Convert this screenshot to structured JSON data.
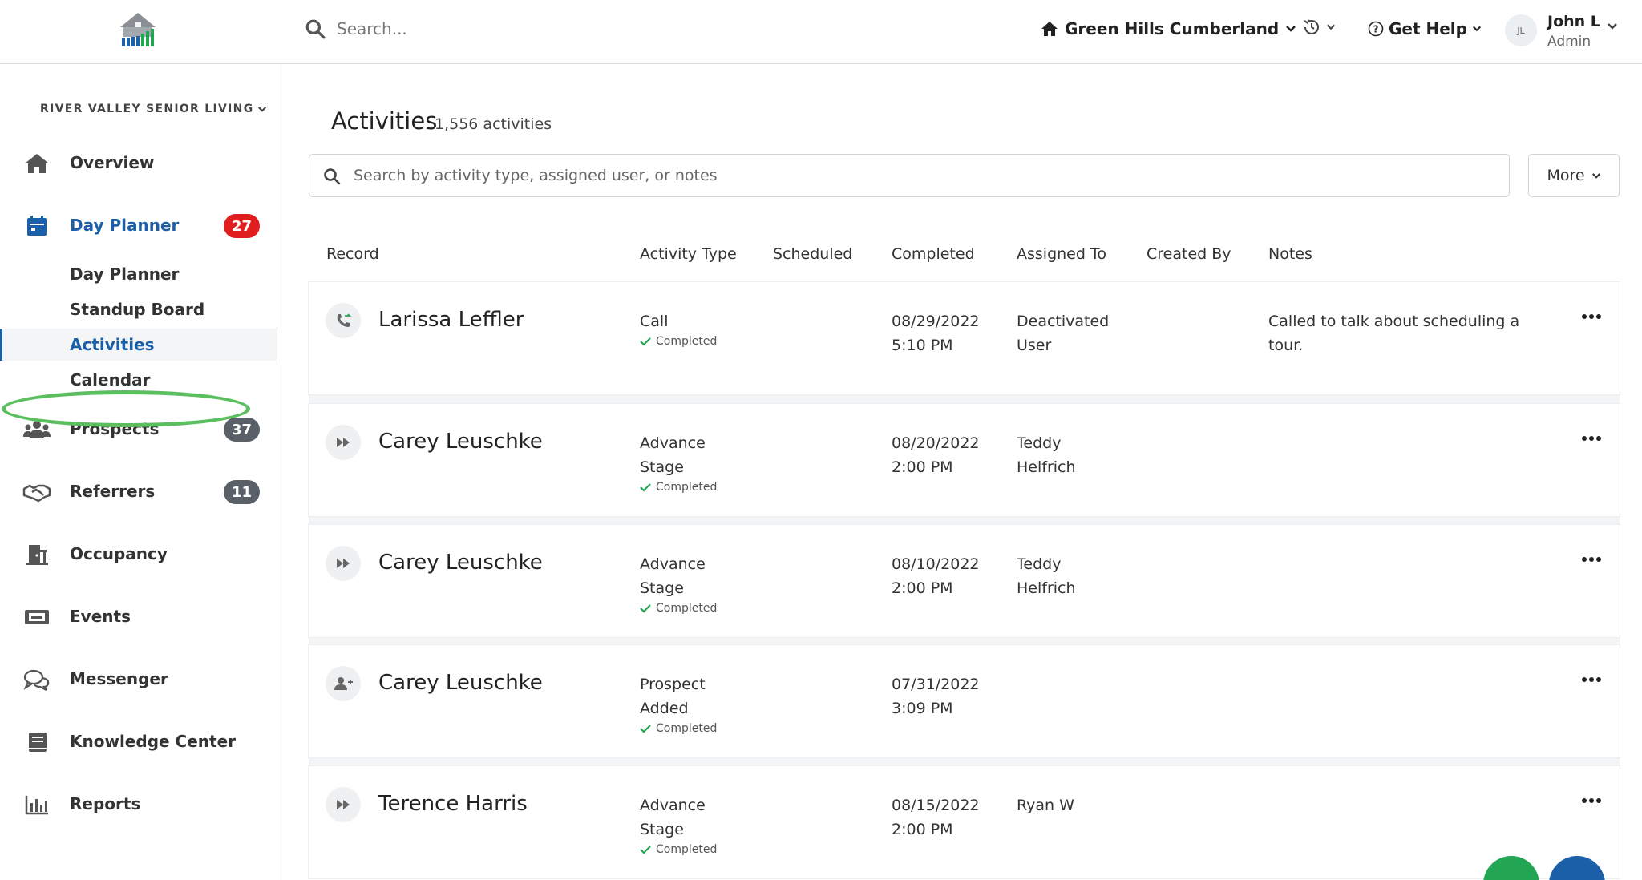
{
  "topbar": {
    "search_placeholder": "Search...",
    "community": "Green Hills Cumberland",
    "help": "Get Help",
    "user": {
      "initials": "JL",
      "name": "John L",
      "role": "Admin"
    }
  },
  "sidebar": {
    "org": "RIVER VALLEY SENIOR LIVING",
    "overview": "Overview",
    "day_planner": {
      "label": "Day Planner",
      "badge": "27"
    },
    "sub_items": [
      "Day Planner",
      "Standup Board",
      "Activities",
      "Calendar"
    ],
    "prospects": {
      "label": "Prospects",
      "badge": "37"
    },
    "referrers": {
      "label": "Referrers",
      "badge": "11"
    },
    "occupancy": "Occupancy",
    "events": "Events",
    "messenger": "Messenger",
    "knowledge_center": "Knowledge Center",
    "reports": "Reports"
  },
  "main": {
    "title": "Activities",
    "count": "1,556 activities",
    "search_placeholder": "Search by activity type, assigned user, or notes",
    "more_label": "More",
    "columns": [
      "Record",
      "Activity Type",
      "Scheduled",
      "Completed",
      "Assigned To",
      "Created By",
      "Notes"
    ],
    "rows": [
      {
        "icon": "phone-icon",
        "record": "Larissa Leffler",
        "type": "Call",
        "status": "Completed",
        "completed_date": "08/29/2022",
        "completed_time": "5:10 PM",
        "assigned": "Deactivated User",
        "notes": "Called to talk about scheduling a tour."
      },
      {
        "icon": "fast-forward-icon",
        "record": "Carey Leuschke",
        "type": "Advance Stage",
        "status": "Completed",
        "completed_date": "08/20/2022",
        "completed_time": "2:00 PM",
        "assigned": "Teddy Helfrich",
        "notes": ""
      },
      {
        "icon": "fast-forward-icon",
        "record": "Carey Leuschke",
        "type": "Advance Stage",
        "status": "Completed",
        "completed_date": "08/10/2022",
        "completed_time": "2:00 PM",
        "assigned": "Teddy Helfrich",
        "notes": ""
      },
      {
        "icon": "user-plus-icon",
        "record": "Carey Leuschke",
        "type": "Prospect Added",
        "status": "Completed",
        "completed_date": "07/31/2022",
        "completed_time": "3:09 PM",
        "assigned": "",
        "notes": ""
      },
      {
        "icon": "fast-forward-icon",
        "record": "Terence Harris",
        "type": "Advance Stage",
        "status": "Completed",
        "completed_date": "08/15/2022",
        "completed_time": "2:00 PM",
        "assigned": "Ryan W",
        "notes": ""
      }
    ]
  },
  "colors": {
    "accent": "#1b5fa8",
    "badge_red": "#e01e1e",
    "badge_gray": "#5a6068",
    "success": "#22a653",
    "highlight": "#5cbf5f"
  }
}
